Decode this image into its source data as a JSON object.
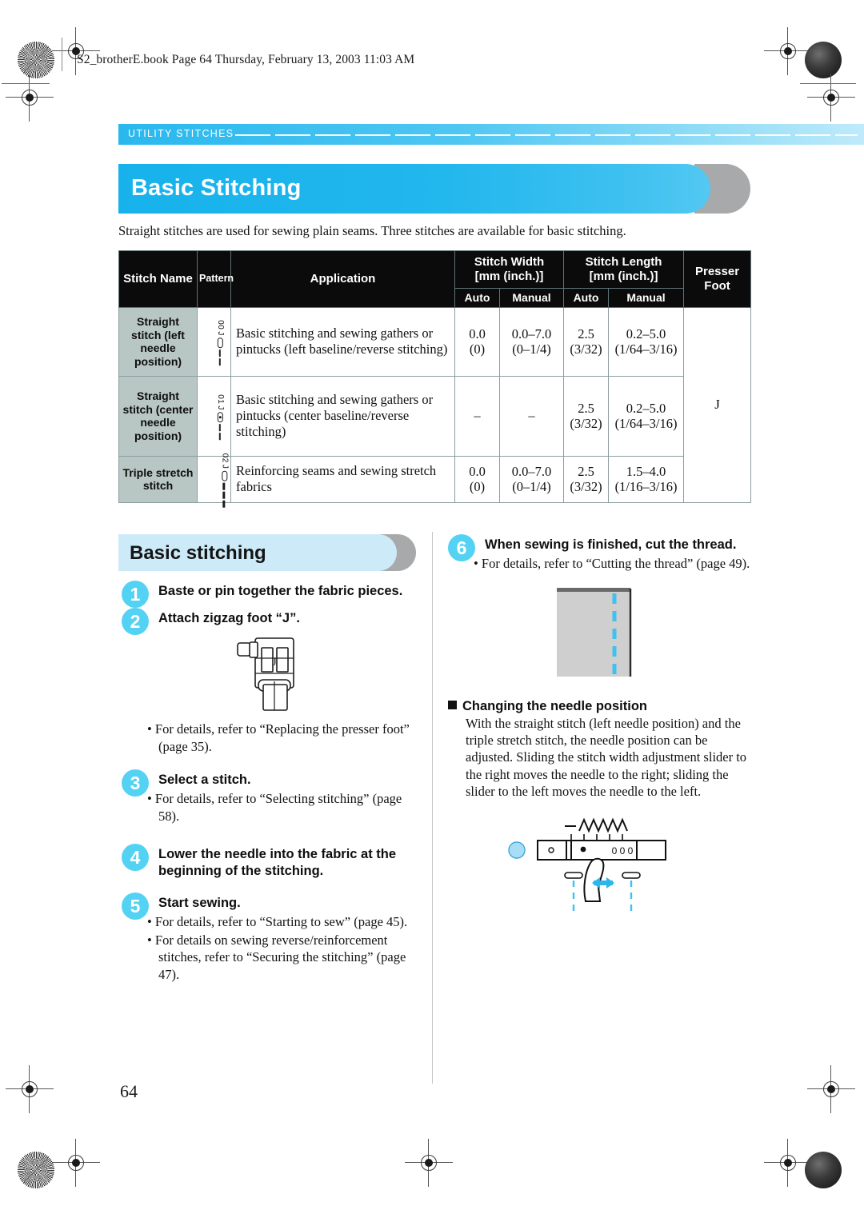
{
  "print_header": {
    "book_info": "S2_brotherE.book  Page 64  Thursday, February 13, 2003  11:03 AM"
  },
  "running_head": {
    "label": "UTILITY STITCHES"
  },
  "title_banner": {
    "title": "Basic Stitching"
  },
  "intro": {
    "text": "Straight stitches are used for sewing plain seams. Three stitches are available for basic stitching."
  },
  "spec_table": {
    "headers": {
      "stitch_name": "Stitch Name",
      "pattern": "Pattern",
      "application": "Application",
      "stitch_width": "Stitch Width",
      "stitch_width_unit": "[mm (inch.)]",
      "stitch_length": "Stitch Length",
      "stitch_length_unit": "[mm (inch.)]",
      "presser_foot_l1": "Presser",
      "presser_foot_l2": "Foot",
      "auto": "Auto",
      "manual": "Manual",
      "auto2": "Auto",
      "manual2": "Manual"
    },
    "rows": [
      {
        "name": "Straight stitch (left needle position)",
        "pattern_number": "00",
        "application": "Basic stitching and sewing gathers or pintucks (left baseline/reverse stitching)",
        "width_auto_mm": "0.0",
        "width_auto_in": "(0)",
        "width_manual_mm": "0.0–7.0",
        "width_manual_in": "(0–1/4)",
        "length_auto_mm": "2.5",
        "length_auto_in": "(3/32)",
        "length_manual_mm": "0.2–5.0",
        "length_manual_in": "(1/64–3/16)"
      },
      {
        "name": "Straight stitch (center needle position)",
        "pattern_number": "01",
        "application": "Basic stitching and sewing gathers or pintucks (center baseline/reverse stitching)",
        "width_auto_mm": "–",
        "width_auto_in": "",
        "width_manual_mm": "–",
        "width_manual_in": "",
        "length_auto_mm": "2.5",
        "length_auto_in": "(3/32)",
        "length_manual_mm": "0.2–5.0",
        "length_manual_in": "(1/64–3/16)"
      },
      {
        "name": "Triple stretch stitch",
        "pattern_number": "02",
        "application": "Reinforcing seams and sewing stretch fabrics",
        "width_auto_mm": "0.0",
        "width_auto_in": "(0)",
        "width_manual_mm": "0.0–7.0",
        "width_manual_in": "(0–1/4)",
        "length_auto_mm": "2.5",
        "length_auto_in": "(3/32)",
        "length_manual_mm": "1.5–4.0",
        "length_manual_in": "(1/16–3/16)"
      }
    ],
    "presser_foot_value": "J"
  },
  "sub_banner": {
    "title": "Basic stitching"
  },
  "left_column": {
    "step1": {
      "number": "1",
      "head": "Baste or pin together the fabric pieces."
    },
    "step2": {
      "number": "2",
      "head": "Attach zigzag foot “J”.",
      "foot_label": "J",
      "note": "• For details, refer to “Replacing the presser foot” (page 35)."
    },
    "step3": {
      "number": "3",
      "head": "Select a stitch.",
      "note": "• For details, refer to “Selecting stitching” (page 58)."
    },
    "step4": {
      "number": "4",
      "head": "Lower the needle into the fabric at the beginning of the stitching."
    },
    "step5": {
      "number": "5",
      "head": "Start sewing.",
      "note1": "• For details, refer to “Starting to sew” (page 45).",
      "note2": "• For details on sewing reverse/reinforcement stitches, refer to “Securing the stitching” (page 47)."
    }
  },
  "right_column": {
    "step6": {
      "number": "6",
      "head": "When sewing is finished, cut the thread.",
      "note": "• For details, refer to “Cutting the thread” (page 49)."
    },
    "needle_position": {
      "head": "Changing the needle position",
      "body": "With the straight stitch (left needle position) and the triple stretch stitch, the needle position can be adjusted. Sliding the stitch width adjustment slider to the right moves the needle to the right; sliding the slider to the left moves the needle to the left.",
      "slider_digits": "0 0 0"
    }
  },
  "footer": {
    "page_number": "64"
  },
  "colors": {
    "accent_blue": "#17b2ec",
    "light_blue": "#cdeaf8",
    "bullet_blue": "#54d2f4",
    "header_black": "#0b0b0b",
    "name_cell_gray": "#b8c6c4",
    "shadow_gray": "#a7a9ab"
  }
}
